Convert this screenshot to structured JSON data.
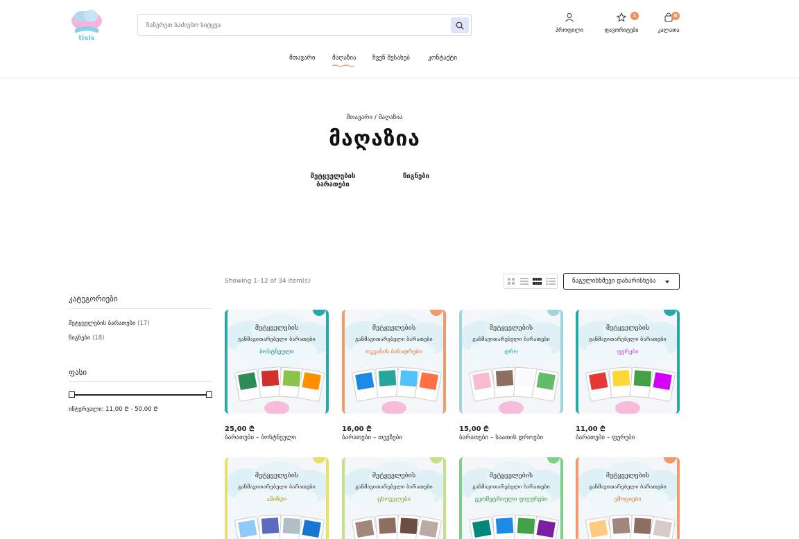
{
  "header": {
    "search_placeholder": "ჩაწერეთ საძიებო სიტყვა",
    "logo_text": "tisis",
    "profile_label": "პროფილი",
    "wishlist_label": "ფავორიტები",
    "wishlist_count": "1",
    "cart_label": "კალათა",
    "cart_count": "0"
  },
  "nav": {
    "home": "მთავარი",
    "shop": "მაღაზია",
    "about": "ჩვენ შესახებ",
    "contact": "კონტაქტი"
  },
  "hero": {
    "breadcrumb_home": "მთავარი",
    "breadcrumb_sep": "/",
    "breadcrumb_current": "მაღაზია",
    "title": "მაღაზია",
    "cat1_line1": "მეტყველების",
    "cat1_line2": "ბარათები",
    "cat2": "წიგნები"
  },
  "sidebar": {
    "categories_title": "კატეგორიები",
    "categories": [
      {
        "label": "მეტყველების ბარათები",
        "count": "(17)"
      },
      {
        "label": "წიგნები",
        "count": "(18)"
      }
    ],
    "price_title": "ფასი",
    "price_range": "ინტერვალი: 11,00 ₾ - 50,00 ₾"
  },
  "toolbar": {
    "showing": "Showing 1–12 of 34 item(s)",
    "sort_label": "ნაგულისხმევი დახარისხება"
  },
  "products": [
    {
      "price": "25,00 ₾",
      "name": "ბარათები – ბოსტნეული",
      "card_title_1": "მეტყველების",
      "card_title_2": "განმავითარებელი ბარათები",
      "card_sub": "ბოსტნეული",
      "border": "#26a8a8",
      "sub_color": "#1e8a8a"
    },
    {
      "price": "16,00 ₾",
      "name": "ბარათები – თევზები",
      "card_title_1": "მეტყველების",
      "card_title_2": "განმავითარებელი ბარათები",
      "card_sub": "ოკეანის ბინადრები",
      "border": "#f29a6a",
      "sub_color": "#e8773a"
    },
    {
      "price": "15,00 ₾",
      "name": "ბარათები – საათის დროები",
      "card_title_1": "მეტყველების",
      "card_title_2": "განმავითარებელი ბარათები",
      "card_sub": "დრო",
      "border": "#9fd6dc",
      "sub_color": "#26a8a8"
    },
    {
      "price": "11,00 ₾",
      "name": "ბარათები – ფერები",
      "card_title_1": "მეტყველების",
      "card_title_2": "განმავითარებელი ბარათები",
      "card_sub": "ფერები",
      "border": "#26a8a8",
      "sub_color": "#c04fd0"
    },
    {
      "price": "",
      "name": "",
      "card_title_1": "მეტყველების",
      "card_title_2": "განმავითარებელი ბარათები",
      "card_sub": "ამინდი",
      "border": "#e8e06a",
      "sub_color": "#b0a020"
    },
    {
      "price": "",
      "name": "",
      "card_title_1": "მეტყველების",
      "card_title_2": "განმავითარებელი ბარათები",
      "card_sub": "ცხოველები",
      "border": "#c6e08a",
      "sub_color": "#8aa62a"
    },
    {
      "price": "",
      "name": "",
      "card_title_1": "მეტყველების",
      "card_title_2": "განმავითარებელი ბარათები",
      "card_sub": "გეომეტრიული ფიგურები",
      "border": "#7fcf8a",
      "sub_color": "#3d9a4a"
    },
    {
      "price": "",
      "name": "",
      "card_title_1": "მეტყველების",
      "card_title_2": "განმავითარებელი ბარათები",
      "card_sub": "ემოციები",
      "border": "#f29a6a",
      "sub_color": "#e8773a"
    }
  ]
}
